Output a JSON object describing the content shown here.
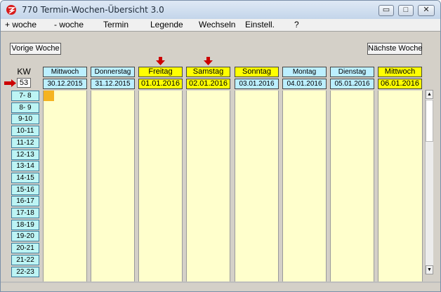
{
  "window": {
    "title": "770 Termin-Wochen-Übersicht 3.0",
    "controls": {
      "minimize": "▭",
      "maximize": "□",
      "close": "✕"
    }
  },
  "menu": [
    "+ woche",
    "- woche",
    "Termin",
    "Legende",
    "Wechseln",
    "Einstell.",
    "?"
  ],
  "nav": {
    "prev": "Vorige Woche",
    "next": "Nächste Woche"
  },
  "kw": {
    "label": "KW",
    "value": "53"
  },
  "time_slots": [
    "7- 8",
    "8- 9",
    "9-10",
    "10-11",
    "11-12",
    "12-13",
    "13-14",
    "14-15",
    "15-16",
    "16-17",
    "17-18",
    "18-19",
    "19-20",
    "20-21",
    "21-22",
    "22-23"
  ],
  "days": [
    {
      "name": "Mittwoch",
      "date": "30.12.2015",
      "highlight": false,
      "marker": false
    },
    {
      "name": "Donnerstag",
      "date": "31.12.2015",
      "highlight": false,
      "marker": false
    },
    {
      "name": "Freitag",
      "date": "01.01.2016",
      "highlight": true,
      "marker": true
    },
    {
      "name": "Samstag",
      "date": "02.01.2016",
      "highlight": true,
      "marker": true
    },
    {
      "name": "Sonntag",
      "date": "03.01.2016",
      "highlight": true,
      "marker": false,
      "date_cyan": true
    },
    {
      "name": "Montag",
      "date": "04.01.2016",
      "highlight": false,
      "marker": false
    },
    {
      "name": "Dienstag",
      "date": "05.01.2016",
      "highlight": false,
      "marker": false
    },
    {
      "name": "Mittwoch",
      "date": "06.01.2016",
      "highlight": true,
      "marker": false
    }
  ],
  "colors": {
    "header_cyan": "#bcefff",
    "header_yellow": "#ffff00",
    "column_bg": "#ffffcc",
    "slot_bg": "#bdf4f4",
    "event": "#f5b320",
    "marker": "#cc0000"
  },
  "scroll": {
    "up": "▲",
    "down": "▼"
  }
}
